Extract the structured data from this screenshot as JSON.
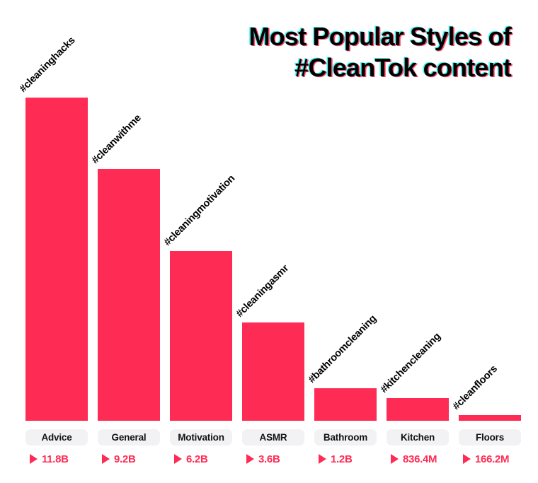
{
  "title": {
    "line1": "Most Popular Styles of",
    "line2": "#CleanTok content"
  },
  "colors": {
    "bar": "#fe2c55",
    "value_text": "#fe2c55",
    "pill_bg": "#f2f2f4",
    "label_text": "#121212",
    "background": "#ffffff"
  },
  "chart_data": {
    "type": "bar",
    "title": "Most Popular Styles of #CleanTok content",
    "xlabel": "",
    "ylabel": "",
    "unit": "views",
    "categories": [
      "Advice",
      "General",
      "Motivation",
      "ASMR",
      "Bathroom",
      "Kitchen",
      "Floors"
    ],
    "hashtags": [
      "#cleaninghacks",
      "#cleanwithme",
      "#cleaningmotivation",
      "#cleaningasmr",
      "#bathroomcleaning",
      "#kitchencleaning",
      "#cleanfloors"
    ],
    "value_labels": [
      "11.8B",
      "9.2B",
      "6.2B",
      "3.6B",
      "1.2B",
      "836.4M",
      "166.2M"
    ],
    "values": [
      11800000000,
      9200000000,
      6200000000,
      3600000000,
      1200000000,
      836400000,
      166200000
    ],
    "values_billions": [
      11.8,
      9.2,
      6.2,
      3.6,
      1.2,
      0.8364,
      0.1662
    ],
    "ylim": [
      0,
      11.8
    ],
    "grid": false,
    "legend": false
  },
  "bars": [
    {
      "category": "Advice",
      "hashtag": "#cleaninghacks",
      "value_label": "11.8B",
      "marker": "play-triangle-icon"
    },
    {
      "category": "General",
      "hashtag": "#cleanwithme",
      "value_label": "9.2B",
      "marker": "play-triangle-icon"
    },
    {
      "category": "Motivation",
      "hashtag": "#cleaningmotivation",
      "value_label": "6.2B",
      "marker": "play-triangle-icon"
    },
    {
      "category": "ASMR",
      "hashtag": "#cleaningasmr",
      "value_label": "3.6B",
      "marker": "play-triangle-icon"
    },
    {
      "category": "Bathroom",
      "hashtag": "#bathroomcleaning",
      "value_label": "1.2B",
      "marker": "play-triangle-icon"
    },
    {
      "category": "Kitchen",
      "hashtag": "#kitchencleaning",
      "value_label": "836.4M",
      "marker": "play-triangle-icon"
    },
    {
      "category": "Floors",
      "hashtag": "#cleanfloors",
      "value_label": "166.2M",
      "marker": "play-triangle-icon"
    }
  ]
}
